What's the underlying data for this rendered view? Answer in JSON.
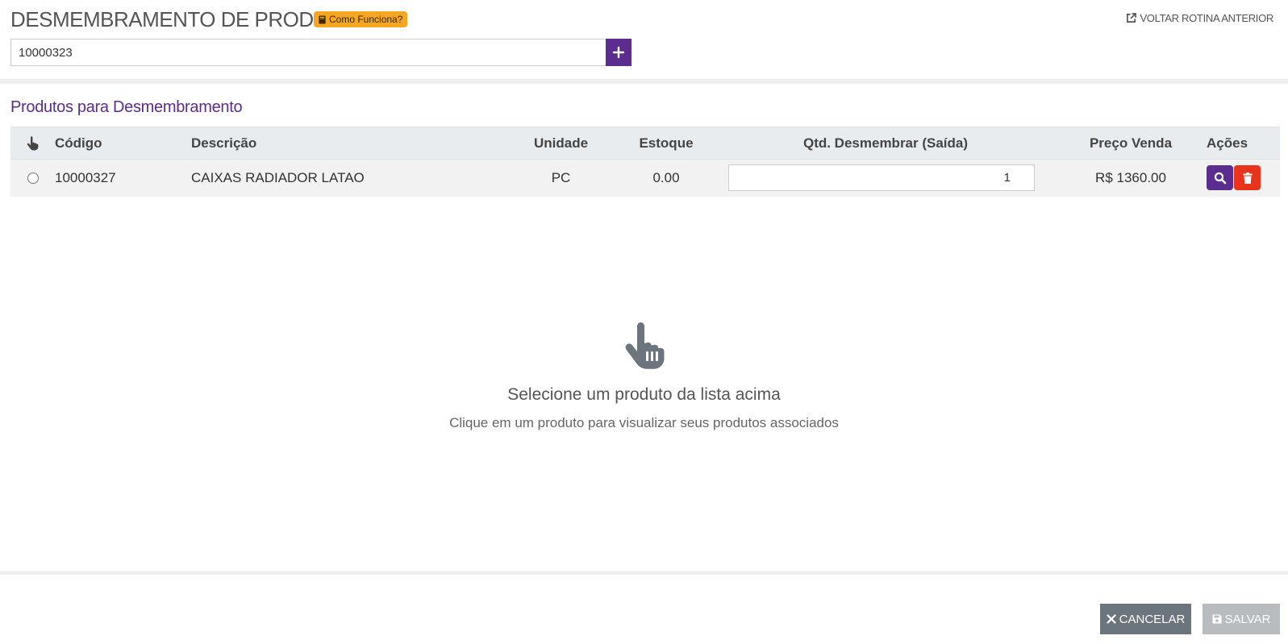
{
  "header": {
    "title": "DESMEMBRAMENTO DE PRODUTOS",
    "help_label": "Como Funciona?",
    "back_label": "VOLTAR ROTINA ANTERIOR",
    "search_value": "10000323"
  },
  "section": {
    "title": "Produtos para Desmembramento"
  },
  "table": {
    "columns": {
      "code": "Código",
      "description": "Descrição",
      "unit": "Unidade",
      "stock": "Estoque",
      "qty": "Qtd. Desmembrar (Saída)",
      "price": "Preço Venda",
      "actions": "Ações"
    },
    "rows": [
      {
        "code": "10000327",
        "description": "CAIXAS RADIADOR LATAO",
        "unit": "PC",
        "stock": "0.00",
        "qty": "1",
        "price": "R$ 1360.00"
      }
    ]
  },
  "empty_state": {
    "title": "Selecione um produto da lista acima",
    "subtitle": "Clique em um produto para visualizar seus produtos associados"
  },
  "footer": {
    "cancel_label": "CANCELAR",
    "save_label": "SALVAR"
  },
  "colors": {
    "brand_purple": "#5b2d8e",
    "help_badge": "#f5a623",
    "delete_red": "#e8341c",
    "cancel_gray": "#6c757d",
    "save_disabled": "#b9bcbf"
  }
}
